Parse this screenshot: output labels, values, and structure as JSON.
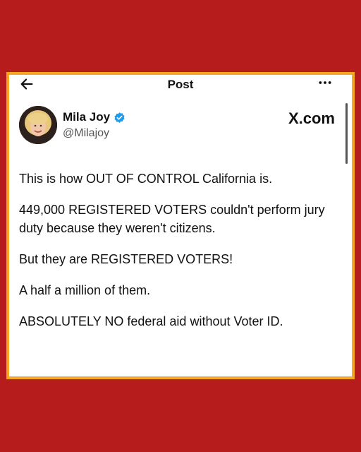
{
  "header": {
    "title": "Post",
    "back_icon": "arrow-left-icon",
    "more_icon": "more-horizontal-icon"
  },
  "author": {
    "name": "Mila Joy",
    "handle": "@Milajoy",
    "verified_color": "#1d9bf0"
  },
  "brand": "X.com",
  "tweet": {
    "paragraphs": [
      "This is how OUT OF CONTROL California is.",
      "449,000 REGISTERED VOTERS couldn't perform jury duty because they weren't citizens.",
      "But they are REGISTERED VOTERS!",
      "A half a million of them.",
      "ABSOLUTELY NO federal aid without Voter ID."
    ]
  },
  "colors": {
    "background": "#b71c1c",
    "frame_border": "#f5a623"
  }
}
